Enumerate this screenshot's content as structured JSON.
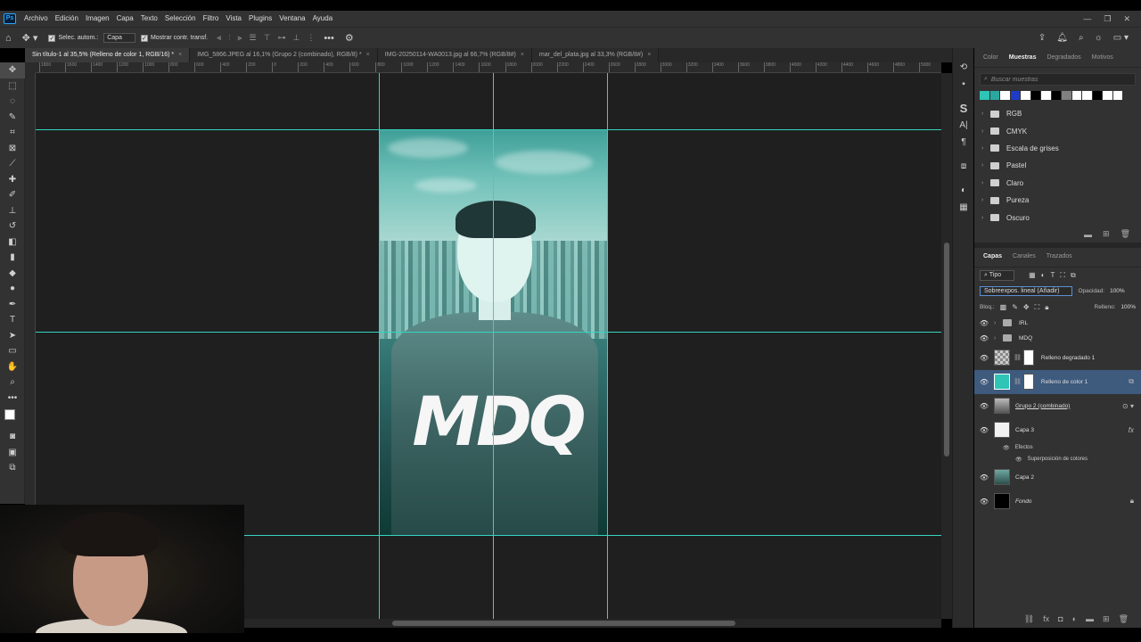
{
  "app": {
    "logo": "Ps"
  },
  "menu": [
    "Archivo",
    "Edición",
    "Imagen",
    "Capa",
    "Texto",
    "Selección",
    "Filtro",
    "Vista",
    "Plugins",
    "Ventana",
    "Ayuda"
  ],
  "window_controls": [
    "—",
    "❐",
    "✕"
  ],
  "options_bar": {
    "auto_select_label": "Selec. autom.:",
    "auto_select_value": "Capa",
    "show_transform_label": "Mostrar contr. transf.",
    "more": "•••"
  },
  "tabs": [
    {
      "label": "Sin título-1 al 35,5% (Relleno de color 1, RGB/16) *",
      "active": true
    },
    {
      "label": "IMG_5866.JPEG al 16,1% (Grupo 2 (combinado), RGB/8) *",
      "active": false
    },
    {
      "label": "IMG-20250114-WA0013.jpg al 66,7% (RGB/8#)",
      "active": false
    },
    {
      "label": "mar_del_plata.jpg al 33,3% (RGB/8#)",
      "active": false
    }
  ],
  "ruler_ticks": [
    "1800",
    "1600",
    "1400",
    "1200",
    "1000",
    "800",
    "600",
    "400",
    "200",
    "0",
    "200",
    "400",
    "600",
    "800",
    "1000",
    "1200",
    "1400",
    "1600",
    "1800",
    "2000",
    "2200",
    "2400",
    "2600",
    "2800",
    "3000",
    "3200",
    "3400",
    "3600",
    "3800",
    "4000",
    "4200",
    "4400",
    "4600",
    "4800",
    "5000"
  ],
  "artboard": {
    "text": "MDQ"
  },
  "panels": {
    "swatches_tabs": [
      "Color",
      "Muestras",
      "Degradados",
      "Motivos"
    ],
    "swatches_active": "Muestras",
    "search_placeholder": "Buscar muestras",
    "swatch_colors": [
      "#2ec4b6",
      "#2aa8a0",
      "#ffffff",
      "#1e3cc8",
      "#ffffff",
      "#000000",
      "#ffffff",
      "#000000",
      "#808080",
      "#ffffff",
      "#ffffff",
      "#000000",
      "#ffffff",
      "#ffffff"
    ],
    "swatch_groups": [
      "RGB",
      "CMYK",
      "Escala de grises",
      "Pastel",
      "Claro",
      "Pureza",
      "Oscuro"
    ],
    "layers_tabs": [
      "Capas",
      "Canales",
      "Trazados"
    ],
    "layers_active": "Capas",
    "filter_kind": "Tipo",
    "blend_mode": "Sobreexpos. lineal (Añadir)",
    "opacity_label": "Opacidad:",
    "opacity_value": "100%",
    "lock_label": "Bloq.:",
    "fill_label": "Relleno:",
    "fill_value": "100%",
    "layers": [
      {
        "name": "IRL",
        "kind": "group"
      },
      {
        "name": "MDQ",
        "kind": "group"
      },
      {
        "name": "Relleno degradado 1",
        "kind": "gradient-fill"
      },
      {
        "name": "Relleno de color 1",
        "kind": "color-fill",
        "selected": true
      },
      {
        "name": "Grupo 2 (combinado)",
        "kind": "smart-object"
      },
      {
        "name": "Capa 3",
        "kind": "pixel",
        "fx": "fx"
      },
      {
        "name": "Efectos",
        "kind": "effects"
      },
      {
        "name": "Superposición de colores",
        "kind": "effect"
      },
      {
        "name": "Capa 2",
        "kind": "pixel"
      },
      {
        "name": "Fondo",
        "kind": "background"
      }
    ]
  },
  "colors": {
    "guide": "#35d4c0",
    "selected_layer": "#3e5a7d",
    "fill_color": "#2ec4b6"
  }
}
